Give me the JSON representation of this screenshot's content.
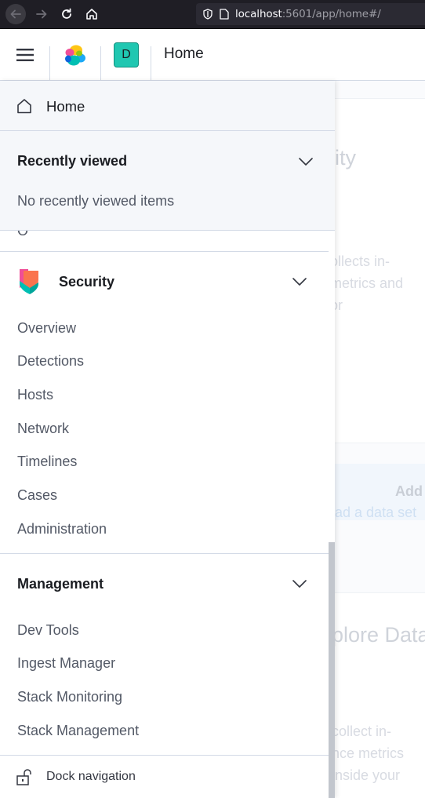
{
  "browser": {
    "url_host": "localhost",
    "url_rest": ":5601/app/home#/"
  },
  "header": {
    "space_initial": "D",
    "breadcrumb": "Home"
  },
  "nav": {
    "home_label": "Home",
    "recently_viewed": {
      "title": "Recently viewed",
      "empty_text": "No recently viewed items"
    },
    "partial_item": "O",
    "security": {
      "title": "Security",
      "items": [
        "Overview",
        "Detections",
        "Hosts",
        "Network",
        "Timelines",
        "Cases",
        "Administration"
      ]
    },
    "management": {
      "title": "Management",
      "items": [
        "Dev Tools",
        "Ingest Manager",
        "Stack Monitoring",
        "Stack Management"
      ]
    },
    "dock_label": "Dock navigation"
  },
  "background": {
    "title1": "ility",
    "body1": [
      "ollects in-",
      "metrics and",
      "or"
    ],
    "add_title": "Add",
    "add_sub": "oad a data set",
    "title2": "plore Data",
    "body2": [
      "collect in-",
      "nce metrics",
      "inside your"
    ]
  },
  "colors": {
    "space_avatar": "#20c7b1",
    "browser_chrome": "#1f1e25",
    "nav_bg_pinned": "#f5f7fa",
    "text_primary": "#1a1c21",
    "text_secondary": "#535966"
  }
}
